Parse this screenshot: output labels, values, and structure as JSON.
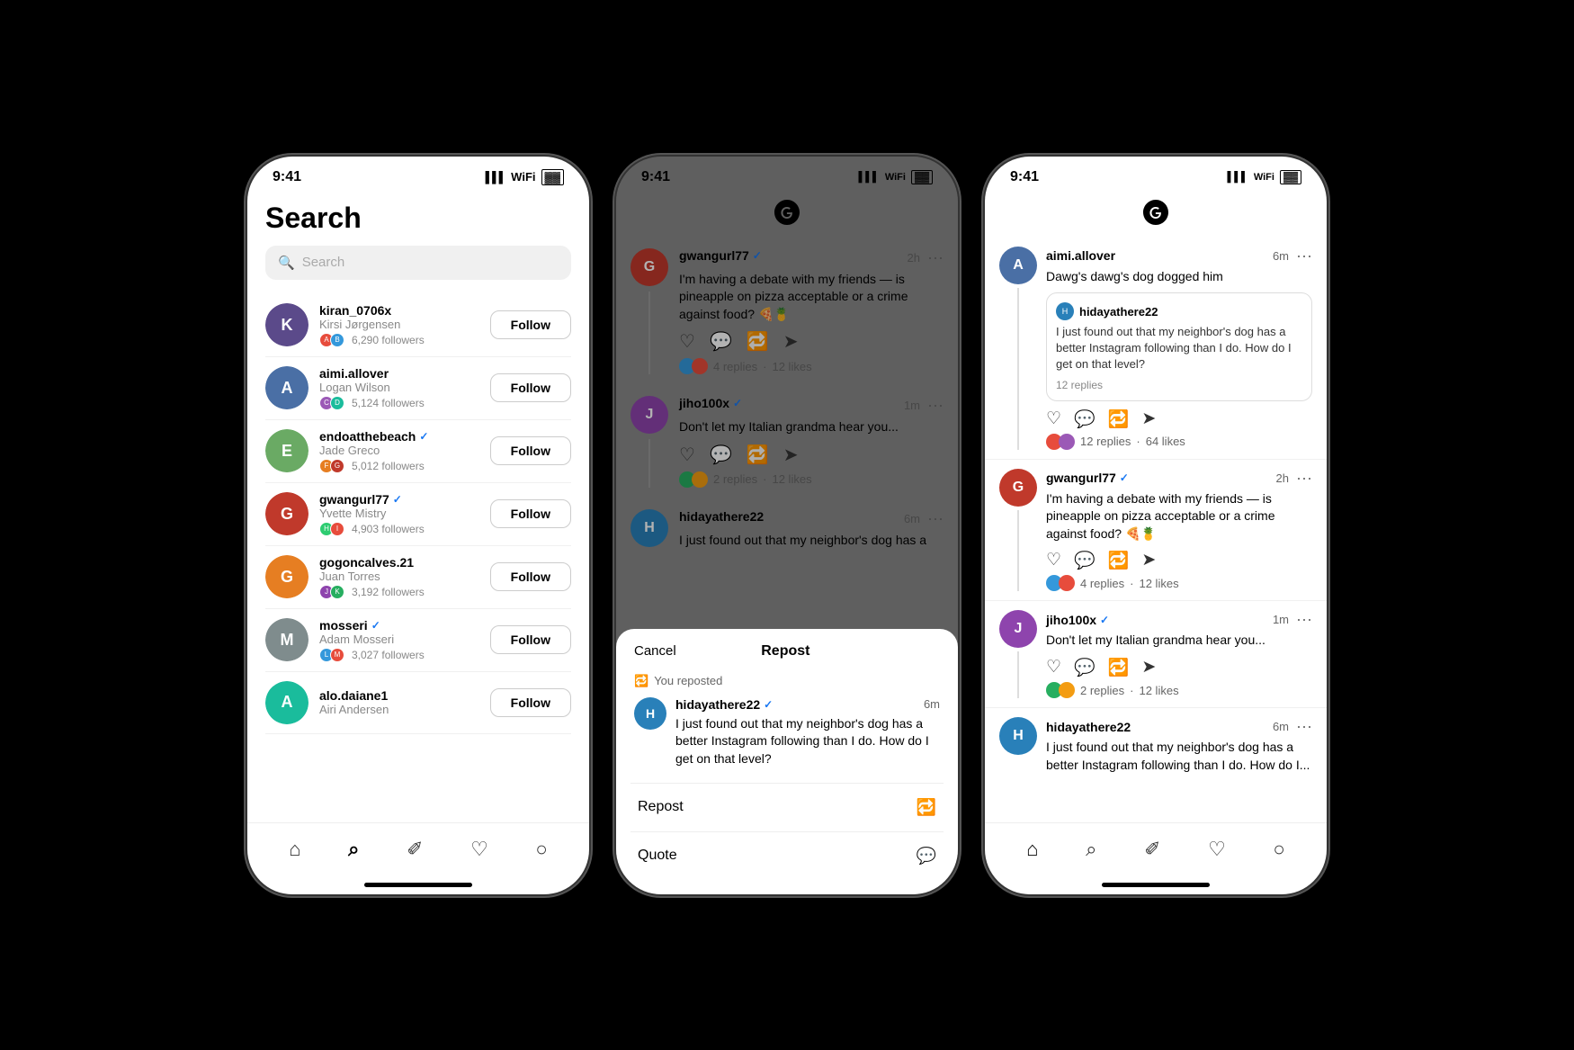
{
  "phone1": {
    "status_time": "9:41",
    "title": "Search",
    "search_placeholder": "Search",
    "users": [
      {
        "username": "kiran_0706x",
        "display_name": "Kirsi Jørgensen",
        "followers": "6,290 followers",
        "color": "#5b4a8a"
      },
      {
        "username": "aimi.allover",
        "display_name": "Logan Wilson",
        "followers": "5,124 followers",
        "color": "#4a6fa5"
      },
      {
        "username": "endoatthebeach",
        "display_name": "Jade Greco",
        "followers": "5,012 followers",
        "verified": true,
        "color": "#6aaa64"
      },
      {
        "username": "gwangurl77",
        "display_name": "Yvette Mistry",
        "followers": "4,903 followers",
        "verified": true,
        "color": "#c0392b"
      },
      {
        "username": "gogoncalves.21",
        "display_name": "Juan Torres",
        "followers": "3,192 followers",
        "color": "#e67e22"
      },
      {
        "username": "mosseri",
        "display_name": "Adam Mosseri",
        "followers": "3,027 followers",
        "verified": true,
        "color": "#7f8c8d"
      },
      {
        "username": "alo.daiane1",
        "display_name": "Airi Andersen",
        "followers": "",
        "color": "#1abc9c"
      }
    ],
    "follow_label": "Follow",
    "nav": [
      "🏠",
      "🔍",
      "✏️",
      "♡",
      "👤"
    ]
  },
  "phone2": {
    "status_time": "9:41",
    "posts": [
      {
        "username": "gwangurl77",
        "verified": true,
        "time": "2h",
        "text": "I'm having a debate with my friends — is pineapple on pizza acceptable or a crime against food? 🍕🍍",
        "replies": "4 replies",
        "likes": "12 likes",
        "color": "#c0392b"
      },
      {
        "username": "jiho100x",
        "verified": true,
        "time": "1m",
        "text": "Don't let my Italian grandma hear you...",
        "replies": "2 replies",
        "likes": "12 likes",
        "color": "#8e44ad"
      },
      {
        "username": "hidayathere22",
        "verified": false,
        "time": "6m",
        "text": "I just found out that my neighbor's dog has a",
        "color": "#2980b9"
      }
    ],
    "modal": {
      "cancel_label": "Cancel",
      "title": "Repost",
      "reposted_label": "You reposted",
      "post_username": "hidayathere22",
      "post_verified": true,
      "post_time": "6m",
      "post_text": "I just found out that my neighbor's dog has a better Instagram following than I do. How do I get on that level?",
      "repost_label": "Repost",
      "quote_label": "Quote"
    }
  },
  "phone3": {
    "status_time": "9:41",
    "posts": [
      {
        "username": "aimi.allover",
        "verified": false,
        "time": "6m",
        "text": "Dawg's dawg's dog dogged him",
        "quoted_username": "hidayathere22",
        "quoted_text": "I just found out that my neighbor's dog has a better Instagram following than I do. How do I get on that level?",
        "quoted_replies": "12 replies",
        "replies": "12 replies",
        "likes": "64 likes",
        "color": "#4a6fa5"
      },
      {
        "username": "gwangurl77",
        "verified": true,
        "time": "2h",
        "text": "I'm having a debate with my friends — is pineapple on pizza acceptable or a crime against food? 🍕🍍",
        "replies": "4 replies",
        "likes": "12 likes",
        "color": "#c0392b"
      },
      {
        "username": "jiho100x",
        "verified": true,
        "time": "1m",
        "text": "Don't let my Italian grandma hear you...",
        "replies": "2 replies",
        "likes": "12 likes",
        "color": "#8e44ad"
      },
      {
        "username": "hidayathere22",
        "verified": false,
        "time": "6m",
        "text": "I just found out that my neighbor's dog has a better Instagram following than I do. How do I...",
        "color": "#2980b9"
      }
    ],
    "nav_active": "home"
  },
  "verified_symbol": "✓",
  "more_symbol": "···",
  "icons": {
    "heart": "♡",
    "comment": "💬",
    "repost": "🔁",
    "share": "➤",
    "home": "⌂",
    "search": "⌕",
    "compose": "✐",
    "activity": "♥",
    "profile": "◯",
    "threads_logo": "@"
  }
}
